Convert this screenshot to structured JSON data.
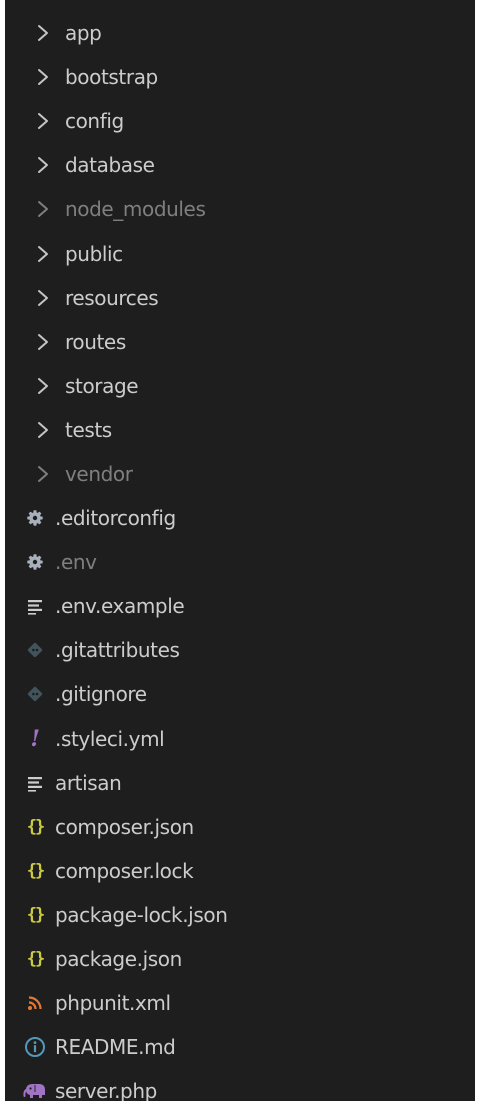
{
  "explorer": {
    "items": [
      {
        "label": "app",
        "kind": "folder",
        "icon": "chevron-right-icon",
        "dim": false
      },
      {
        "label": "bootstrap",
        "kind": "folder",
        "icon": "chevron-right-icon",
        "dim": false
      },
      {
        "label": "config",
        "kind": "folder",
        "icon": "chevron-right-icon",
        "dim": false
      },
      {
        "label": "database",
        "kind": "folder",
        "icon": "chevron-right-icon",
        "dim": false
      },
      {
        "label": "node_modules",
        "kind": "folder",
        "icon": "chevron-right-icon",
        "dim": true
      },
      {
        "label": "public",
        "kind": "folder",
        "icon": "chevron-right-icon",
        "dim": false
      },
      {
        "label": "resources",
        "kind": "folder",
        "icon": "chevron-right-icon",
        "dim": false
      },
      {
        "label": "routes",
        "kind": "folder",
        "icon": "chevron-right-icon",
        "dim": false
      },
      {
        "label": "storage",
        "kind": "folder",
        "icon": "chevron-right-icon",
        "dim": false
      },
      {
        "label": "tests",
        "kind": "folder",
        "icon": "chevron-right-icon",
        "dim": false
      },
      {
        "label": "vendor",
        "kind": "folder",
        "icon": "chevron-right-icon",
        "dim": true
      },
      {
        "label": ".editorconfig",
        "kind": "file",
        "icon": "gear-icon",
        "dim": false
      },
      {
        "label": ".env",
        "kind": "file",
        "icon": "gear-icon",
        "dim": true
      },
      {
        "label": ".env.example",
        "kind": "file",
        "icon": "text-lines-icon",
        "dim": false
      },
      {
        "label": ".gitattributes",
        "kind": "file",
        "icon": "git-diamond-icon",
        "dim": false
      },
      {
        "label": ".gitignore",
        "kind": "file",
        "icon": "git-diamond-icon",
        "dim": false
      },
      {
        "label": ".styleci.yml",
        "kind": "file",
        "icon": "exclamation-icon",
        "dim": false
      },
      {
        "label": "artisan",
        "kind": "file",
        "icon": "text-lines-icon",
        "dim": false
      },
      {
        "label": "composer.json",
        "kind": "file",
        "icon": "json-braces-icon",
        "dim": false
      },
      {
        "label": "composer.lock",
        "kind": "file",
        "icon": "json-braces-icon",
        "dim": false
      },
      {
        "label": "package-lock.json",
        "kind": "file",
        "icon": "json-braces-icon",
        "dim": false
      },
      {
        "label": "package.json",
        "kind": "file",
        "icon": "json-braces-icon",
        "dim": false
      },
      {
        "label": "phpunit.xml",
        "kind": "file",
        "icon": "rss-icon",
        "dim": false
      },
      {
        "label": "README.md",
        "kind": "file",
        "icon": "info-icon",
        "dim": false
      },
      {
        "label": "server.php",
        "kind": "file",
        "icon": "php-elephant-icon",
        "dim": false
      }
    ]
  },
  "colors": {
    "background": "#1e1e1e",
    "text": "#cccccc",
    "dimmed_text": "#7f7f7f",
    "json_icon": "#cbcb41",
    "yml_icon": "#a074c4",
    "xml_icon": "#e37933",
    "info_icon": "#519aba",
    "php_icon": "#a074c4",
    "config_icon": "#a8b0bc",
    "git_icon": "#41535b"
  },
  "icon_glyphs": {
    "json_braces": "{}",
    "exclamation": "!"
  }
}
